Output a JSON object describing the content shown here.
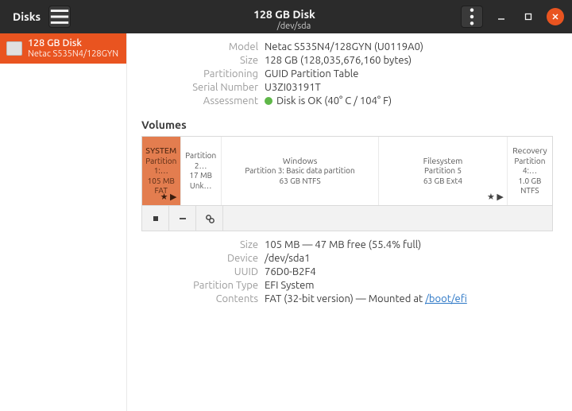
{
  "appTitle": "Disks",
  "header": {
    "title": "128 GB Disk",
    "subtitle": "/dev/sda"
  },
  "sidebar": {
    "entry": {
      "title": "128 GB Disk",
      "subtitle": "Netac S535N4/128GYN"
    }
  },
  "disk": {
    "model_lbl": "Model",
    "model_val": "Netac S535N4/128GYN (U0119A0)",
    "size_lbl": "Size",
    "size_val": "128 GB (128,035,676,160 bytes)",
    "part_lbl": "Partitioning",
    "part_val": "GUID Partition Table",
    "serial_lbl": "Serial Number",
    "serial_val": "U3ZI03191T",
    "assess_lbl": "Assessment",
    "assess_val": "Disk is OK (40° C / 104° F)"
  },
  "volumesHeading": "Volumes",
  "partitions": [
    {
      "name": "SYSTEM",
      "sub1": "Partition 1:…",
      "sub2": "105 MB FAT",
      "widthPx": 50,
      "selected": true,
      "icons": "★ ▶"
    },
    {
      "name": "",
      "sub1": "Partition 2…",
      "sub2": "17 MB Unk…",
      "widthPx": 53,
      "selected": false,
      "icons": ""
    },
    {
      "name": "Windows",
      "sub1": "Partition 3: Basic data partition",
      "sub2": "63 GB NTFS",
      "widthPx": 205,
      "selected": false,
      "icons": ""
    },
    {
      "name": "Filesystem",
      "sub1": "Partition 5",
      "sub2": "63 GB Ext4",
      "widthPx": 167,
      "selected": false,
      "icons": "★ ▶"
    },
    {
      "name": "Recovery",
      "sub1": "Partition 4:…",
      "sub2": "1.0 GB NTFS",
      "widthPx": 58,
      "selected": false,
      "icons": ""
    }
  ],
  "volinfo": {
    "size_lbl": "Size",
    "size_val": "105 MB — 47 MB free (55.4% full)",
    "device_lbl": "Device",
    "device_val": "/dev/sda1",
    "uuid_lbl": "UUID",
    "uuid_val": "76D0-B2F4",
    "ptype_lbl": "Partition Type",
    "ptype_val": "EFI System",
    "contents_lbl": "Contents",
    "contents_prefix": "FAT (32-bit version) — Mounted at ",
    "contents_link": "/boot/efi"
  }
}
